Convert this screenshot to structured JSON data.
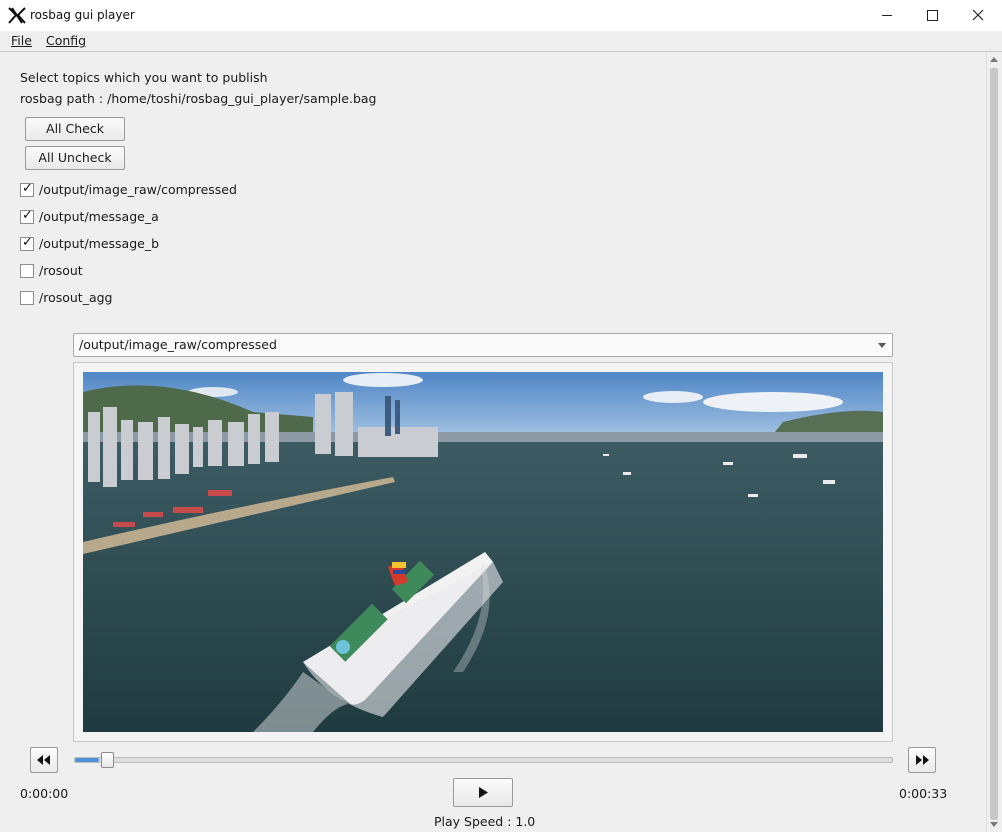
{
  "window": {
    "title": "rosbag gui player"
  },
  "menu": {
    "file": "File",
    "config": "Config"
  },
  "info": {
    "instruction": "Select topics which you want to publish",
    "path": "rosbag path : /home/toshi/rosbag_gui_player/sample.bag"
  },
  "buttons": {
    "all_check": "All Check",
    "all_uncheck": "All Uncheck"
  },
  "topics": [
    {
      "name": "/output/image_raw/compressed",
      "checked": true
    },
    {
      "name": "/output/message_a",
      "checked": true
    },
    {
      "name": "/output/message_b",
      "checked": true
    },
    {
      "name": "/rosout",
      "checked": false
    },
    {
      "name": "/rosout_agg",
      "checked": false
    }
  ],
  "image_topic_select": {
    "selected": "/output/image_raw/compressed"
  },
  "playback": {
    "current_time": "0:00:00",
    "total_time": "0:00:33",
    "speed": "Play Speed : 1.0",
    "progress": 0.02
  },
  "icons": {
    "logo": "x-logo-icon",
    "minimize": "minimize-icon",
    "maximize": "maximize-icon",
    "close": "close-icon",
    "rewind": "rewind-icon",
    "fast_forward": "fast-forward-icon",
    "play": "play-icon",
    "dropdown": "chevron-down-icon"
  },
  "colors": {
    "accent": "#4d8fd9"
  }
}
